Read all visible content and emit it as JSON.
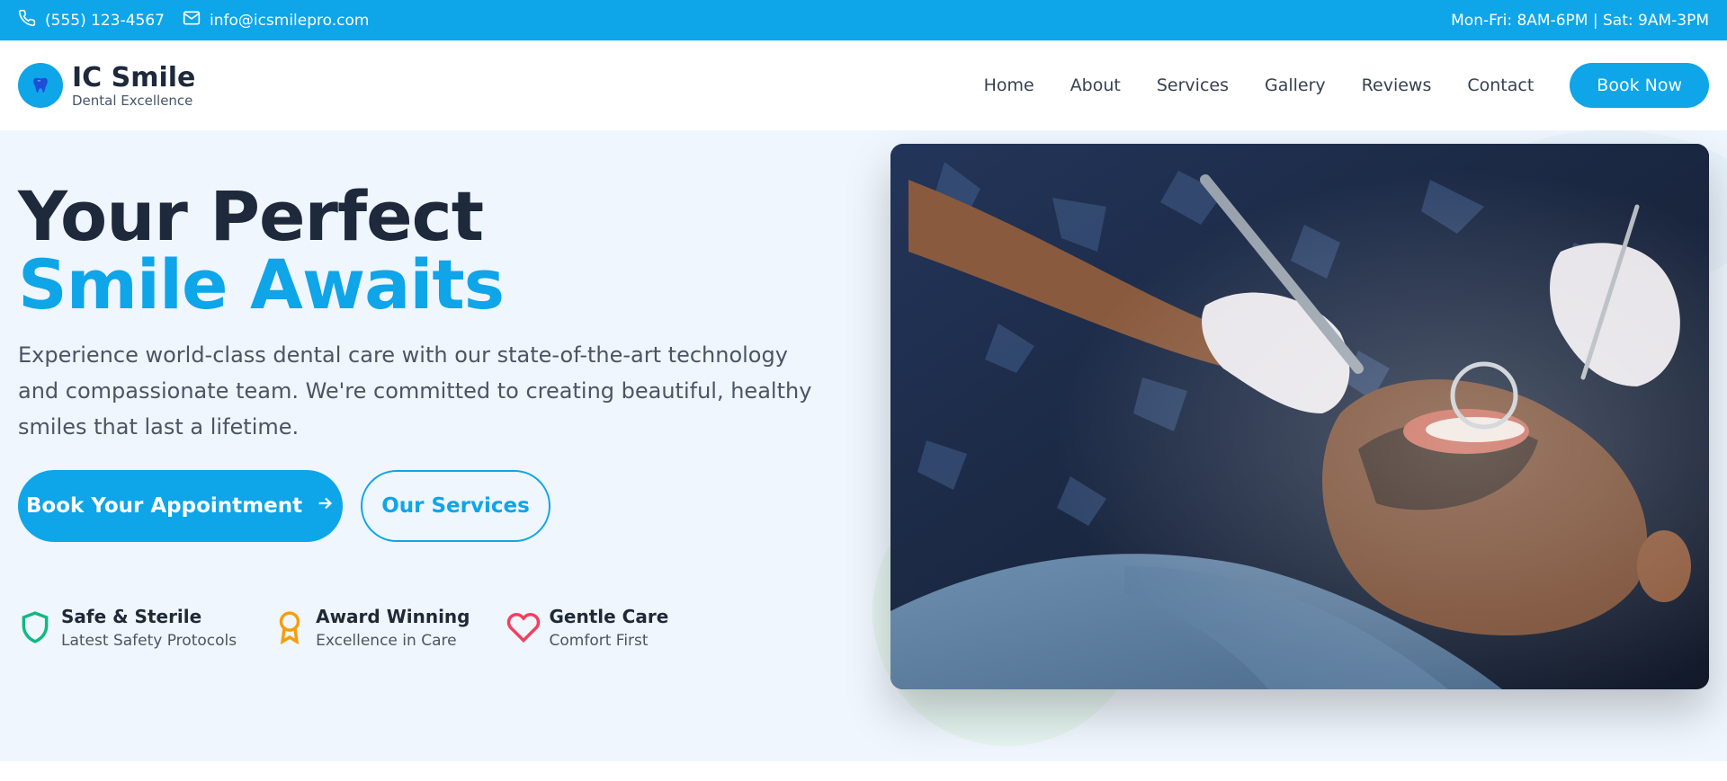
{
  "topbar": {
    "phone": "(555) 123-4567",
    "email": "info@icsmilepro.com",
    "hours": "Mon-Fri: 8AM-6PM | Sat: 9AM-3PM",
    "icons": [
      "phone-icon",
      "mail-icon"
    ]
  },
  "brand": {
    "name": "IC Smile",
    "tagline": "Dental Excellence",
    "logo_icon": "tooth-icon"
  },
  "nav": {
    "items": [
      "Home",
      "About",
      "Services",
      "Gallery",
      "Reviews",
      "Contact"
    ],
    "cta": "Book Now"
  },
  "hero": {
    "title_line1": "Your Perfect",
    "title_line2": "Smile Awaits",
    "description": "Experience world-class dental care with our state-of-the-art technology and compassionate team. We're committed to creating beautiful, healthy smiles that last a lifetime.",
    "primary_button": "Book Your Appointment",
    "secondary_button": "Our Services"
  },
  "features": [
    {
      "title": "Safe & Sterile",
      "subtitle": "Latest Safety Protocols",
      "icon": "shield-icon",
      "color": "#10b981"
    },
    {
      "title": "Award Winning",
      "subtitle": "Excellence in Care",
      "icon": "award-icon",
      "color": "#f59e0b"
    },
    {
      "title": "Gentle Care",
      "subtitle": "Comfort First",
      "icon": "heart-icon",
      "color": "#f43f5e"
    }
  ],
  "colors": {
    "accent": "#0ea5e9",
    "hero_bg": "#eff6fd",
    "heading": "#1e293b"
  }
}
